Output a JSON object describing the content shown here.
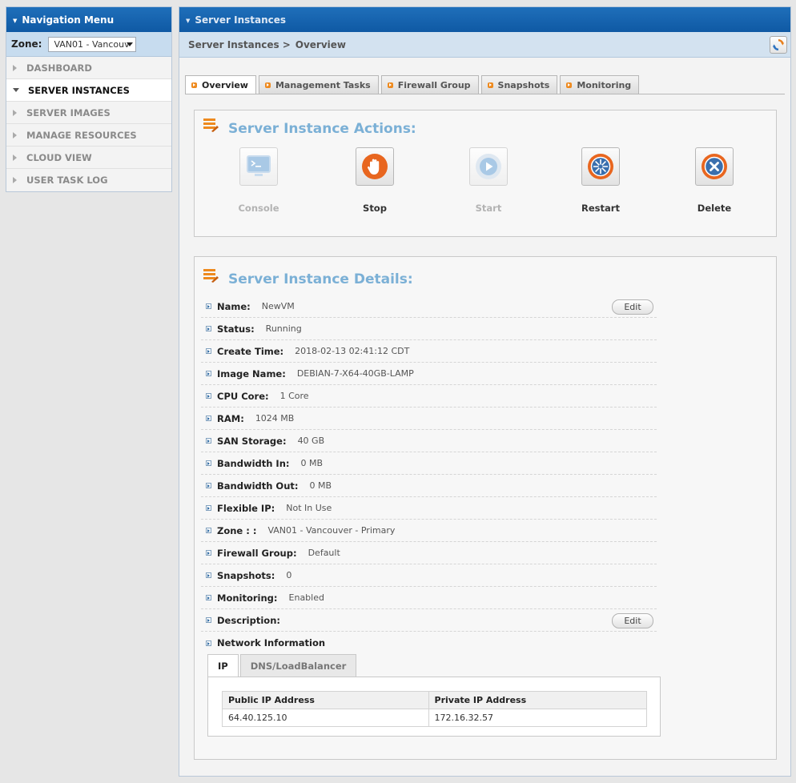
{
  "nav": {
    "title": "Navigation Menu",
    "zone_label": "Zone:",
    "zone_value": "VAN01 - Vancouv",
    "items": [
      {
        "label": "DASHBOARD"
      },
      {
        "label": "SERVER INSTANCES"
      },
      {
        "label": "SERVER IMAGES"
      },
      {
        "label": "MANAGE RESOURCES"
      },
      {
        "label": "CLOUD VIEW"
      },
      {
        "label": "USER TASK LOG"
      }
    ]
  },
  "main": {
    "title": "Server Instances",
    "breadcrumb": [
      "Server Instances",
      ">",
      "Overview"
    ],
    "tabs": [
      {
        "label": "Overview"
      },
      {
        "label": "Management Tasks"
      },
      {
        "label": "Firewall Group"
      },
      {
        "label": "Snapshots"
      },
      {
        "label": "Monitoring"
      }
    ]
  },
  "actions": {
    "title": "Server Instance Actions:",
    "buttons": [
      {
        "label": "Console",
        "enabled": false
      },
      {
        "label": "Stop",
        "enabled": true
      },
      {
        "label": "Start",
        "enabled": false
      },
      {
        "label": "Restart",
        "enabled": true
      },
      {
        "label": "Delete",
        "enabled": true
      }
    ]
  },
  "details": {
    "title": "Server Instance Details:",
    "edit_label": "Edit",
    "rows": [
      {
        "key": "Name:",
        "value": "NewVM"
      },
      {
        "key": "Status:",
        "value": "Running"
      },
      {
        "key": "Create Time:",
        "value": "2018-02-13 02:41:12 CDT"
      },
      {
        "key": "Image Name:",
        "value": "DEBIAN-7-X64-40GB-LAMP"
      },
      {
        "key": "CPU Core:",
        "value": "1 Core"
      },
      {
        "key": "RAM:",
        "value": "1024 MB"
      },
      {
        "key": "SAN Storage:",
        "value": "40 GB"
      },
      {
        "key": "Bandwidth In:",
        "value": "0 MB"
      },
      {
        "key": "Bandwidth Out:",
        "value": "0 MB"
      },
      {
        "key": "Flexible IP:",
        "value": "Not In Use"
      },
      {
        "key": "Zone : :",
        "value": "VAN01 - Vancouver - Primary"
      },
      {
        "key": "Firewall Group:",
        "value": "Default"
      },
      {
        "key": "Snapshots:",
        "value": "0"
      },
      {
        "key": "Monitoring:",
        "value": "Enabled"
      },
      {
        "key": "Description:",
        "value": ""
      },
      {
        "key": "Network Information",
        "value": ""
      }
    ],
    "network": {
      "tabs": [
        {
          "label": "IP"
        },
        {
          "label": "DNS/LoadBalancer"
        }
      ],
      "headers": [
        "Public IP Address",
        "Private IP Address"
      ],
      "rows": [
        [
          "64.40.125.10",
          "172.16.32.57"
        ]
      ]
    }
  },
  "colors": {
    "header_blue": "#1565b0",
    "title_blue": "#7bb0d6",
    "accent_orange": "#ee8a1f",
    "stop_orange": "#e8661f",
    "action_blue": "#3a6fae"
  }
}
